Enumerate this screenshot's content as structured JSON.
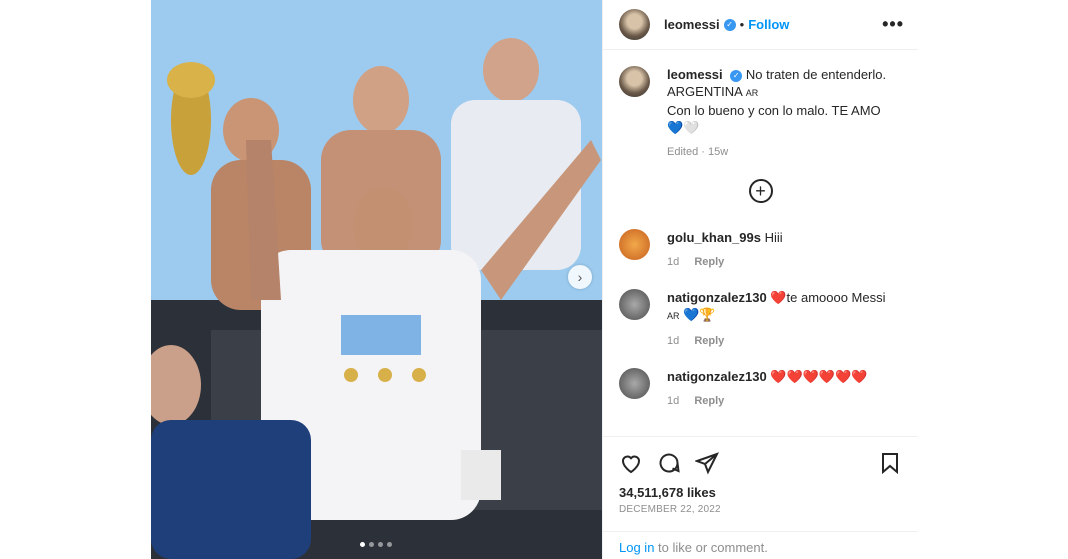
{
  "post": {
    "username": "leomessi",
    "follow_label": "Follow",
    "more_label": "•••",
    "caption": {
      "username": "leomessi",
      "line1": "No traten de entenderlo.",
      "line2": "ARGENTINA",
      "flag": "AR",
      "line3": "Con lo bueno y con lo malo. TE AMO",
      "hearts": "💙🤍",
      "edited": "Edited · 15w"
    },
    "more_comments_icon": "plus-circle-icon",
    "comments": [
      {
        "username": "golu_khan_99s",
        "text": "Hiii",
        "time": "1d",
        "reply": "Reply"
      },
      {
        "username": "natigonzalez130",
        "text": "❤️te amoooo Messi",
        "extra_flag": "AR",
        "extra": "💙🏆",
        "time": "1d",
        "reply": "Reply"
      },
      {
        "username": "natigonzalez130",
        "text": "❤️❤️❤️❤️❤️❤️",
        "time": "1d",
        "reply": "Reply"
      }
    ],
    "likes": "34,511,678 likes",
    "date": "DECEMBER 22, 2022",
    "login_link": "Log in",
    "login_text": " to like or comment."
  },
  "colors": {
    "link": "#0095f6",
    "muted": "#8e8e8e",
    "verified": "#3897f0"
  },
  "carousel": {
    "dots": 4,
    "active_index": 0
  }
}
